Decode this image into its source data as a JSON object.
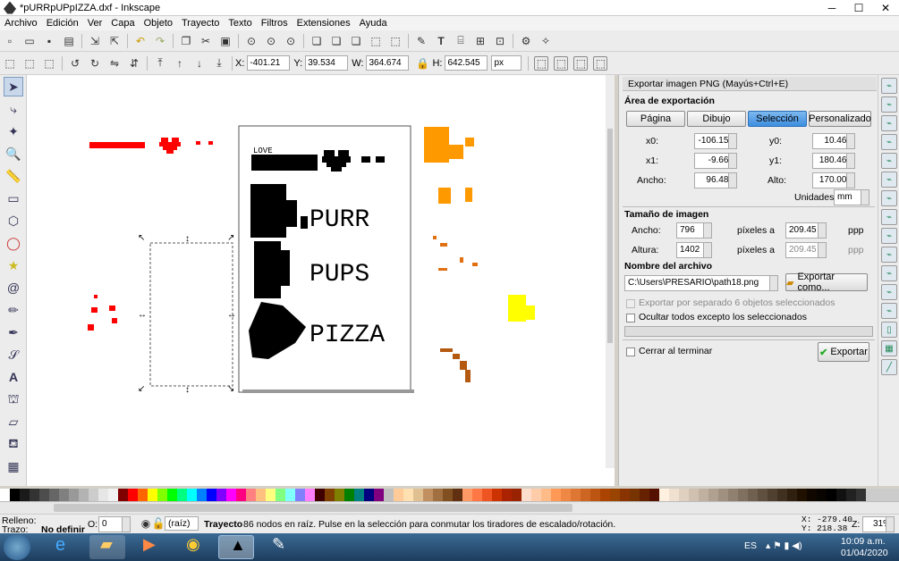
{
  "window": {
    "title": "*pURRpUPpIZZA.dxf - Inkscape",
    "minimize": "─",
    "maximize": "☐",
    "close": "✕"
  },
  "menu": [
    "Archivo",
    "Edición",
    "Ver",
    "Capa",
    "Objeto",
    "Trayecto",
    "Texto",
    "Filtros",
    "Extensiones",
    "Ayuda"
  ],
  "toolbar2": {
    "x_label": "X:",
    "x_value": "-401.21",
    "y_label": "Y:",
    "y_value": "39.534",
    "w_label": "W:",
    "w_value": "364.674",
    "h_label": "H:",
    "h_value": "642.545",
    "unit": "px"
  },
  "canvas": {
    "labels": [
      "LOVE",
      "PURR",
      "PUPS",
      "PIZZA"
    ]
  },
  "dialog": {
    "title": "Exportar imagen PNG (Mayús+Ctrl+E)",
    "area_heading": "Área de exportación",
    "area_buttons": [
      "Página",
      "Dibujo",
      "Selección",
      "Personalizado"
    ],
    "active_area": "Selección",
    "x0_label": "x0:",
    "x0": "-106.154",
    "y0_label": "y0:",
    "y0": "10.460",
    "x1_label": "x1:",
    "x1": "-9.668",
    "y1_label": "y1:",
    "y1": "180.467",
    "width_label": "Ancho:",
    "width": "96.487",
    "height_label": "Alto:",
    "height": "170.007",
    "units_label": "Unidades:",
    "units": "mm",
    "size_heading": "Tamaño de imagen",
    "img_width_label": "Ancho:",
    "img_width": "796",
    "img_height_label": "Altura:",
    "img_height": "1402",
    "pixels_at": "píxeles a",
    "dpi1": "209.45",
    "dpi2": "209.45",
    "ppp": "ppp",
    "filename_heading": "Nombre del archivo",
    "filename": "C:\\Users\\PRESARIO\\path18.png",
    "export_as": "Exportar como...",
    "batch_label": "Exportar por separado 6 objetos seleccionados",
    "hide_label": "Ocultar todos excepto los seleccionados",
    "close_when_done": "Cerrar al terminar",
    "export_button": "Exportar"
  },
  "status": {
    "fill_label": "Relleno:",
    "stroke_label": "Trazo:",
    "stroke_value": "No definir",
    "opacity_label": "O:",
    "opacity_value": "0",
    "layer": "(raíz)",
    "message_bold": "Trayecto",
    "message": " 86 nodos en raíz. Pulse en la selección para conmutar los tiradores de escalado/rotación.",
    "x_coord": "X: -279.40",
    "y_coord": "Y:  218.38",
    "zoom_label": "Z:",
    "zoom": "31%"
  },
  "taskbar": {
    "lang": "ES",
    "time": "10:09 a.m.",
    "date": "01/04/2020"
  }
}
